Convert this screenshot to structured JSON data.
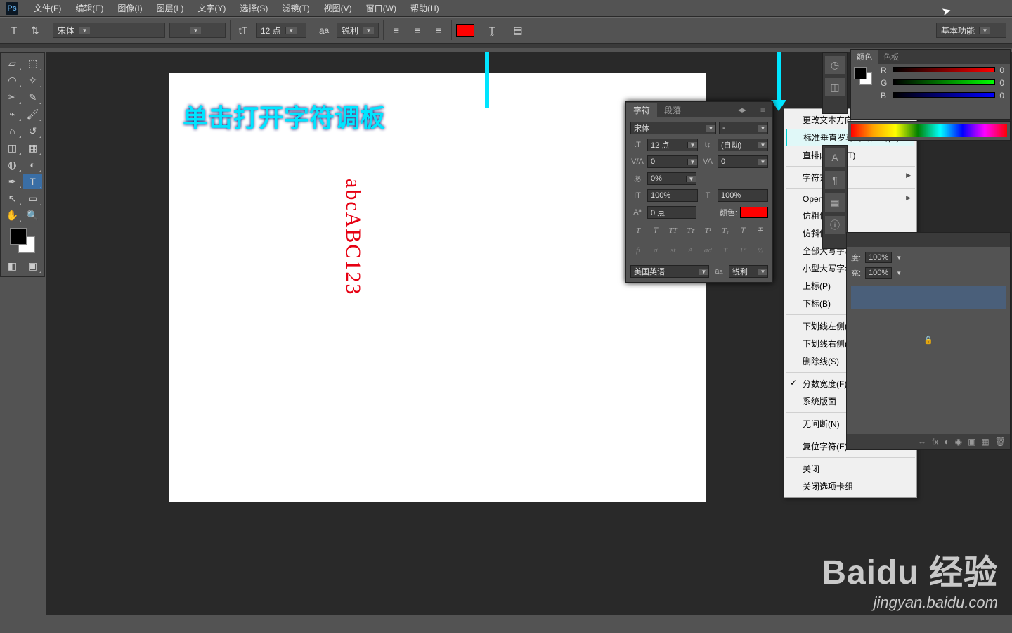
{
  "app": {
    "logo": "Ps"
  },
  "menu": {
    "file": "文件(F)",
    "edit": "编辑(E)",
    "image": "图像(I)",
    "layer": "图层(L)",
    "type": "文字(Y)",
    "select": "选择(S)",
    "filter": "滤镜(T)",
    "view": "视图(V)",
    "window": "窗口(W)",
    "help": "帮助(H)"
  },
  "opt": {
    "font": "宋体",
    "style": "",
    "size": "12 点",
    "aa": "锐利",
    "workspace": "基本功能"
  },
  "canvas": {
    "annotation": "单击打开字符调板",
    "sample_text": "abcABC123"
  },
  "char": {
    "tab_char": "字符",
    "tab_para": "段落",
    "font": "宋体",
    "style": "-",
    "size": "12 点",
    "leading": "(自动)",
    "va": "0",
    "kern": "0",
    "scale": "0%",
    "hscale": "100%",
    "vscale": "100%",
    "baseline": "0 点",
    "color_label": "颜色:",
    "lang": "美国英语",
    "aa": "锐利"
  },
  "ctx": {
    "change_dir": "更改文本方向",
    "std_roman": "标准垂直罗马对齐方式(R)",
    "tate": "直排内横排(T)",
    "align": "字符对齐",
    "opentype": "OpenType",
    "faux_bold": "仿粗体(X)",
    "faux_italic": "仿斜体(I)",
    "all_caps": "全部大写字母(C)",
    "small_caps": "小型大写字母(M)",
    "sup": "上标(P)",
    "sub": "下标(B)",
    "ul_left": "下划线左侧(F)",
    "ul_right": "下划线右侧(G)",
    "strike": "删除线(S)",
    "frac": "分数宽度(F)",
    "sys": "系统版面",
    "nobreak": "无间断(N)",
    "reset": "复位字符(E)",
    "close": "关闭",
    "close_group": "关闭选项卡组"
  },
  "color": {
    "tab_color": "颜色",
    "tab_swatch": "色板",
    "r": "R",
    "g": "G",
    "b": "B",
    "rv": "0",
    "gv": "0",
    "bv": "0"
  },
  "layers": {
    "opacity_label": "度:",
    "opacity": "100%",
    "fill_label": "充:",
    "fill": "100%"
  },
  "watermark": {
    "brand": "Baidu 经验",
    "url": "jingyan.baidu.com"
  }
}
